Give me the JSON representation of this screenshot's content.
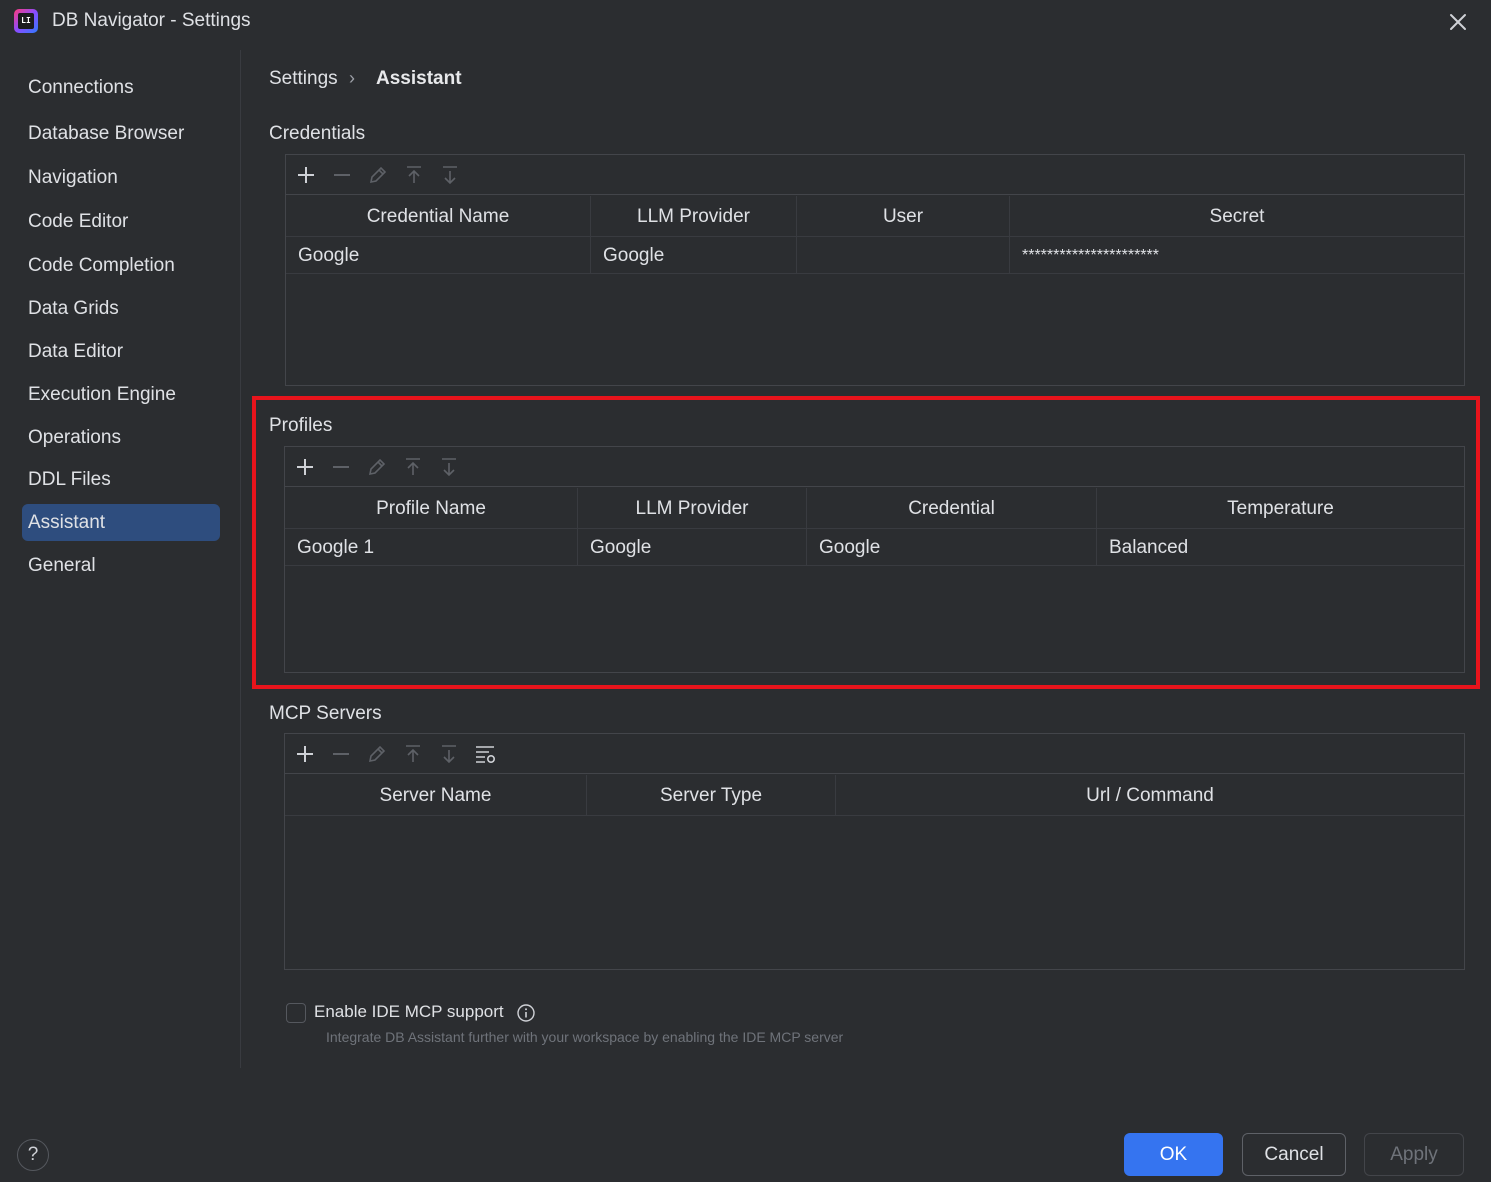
{
  "window": {
    "title": "DB Navigator - Settings",
    "app_icon_text": "LI"
  },
  "sidebar": {
    "items": [
      {
        "label": "Connections"
      },
      {
        "label": "Database Browser"
      },
      {
        "label": "Navigation"
      },
      {
        "label": "Code Editor"
      },
      {
        "label": "Code Completion"
      },
      {
        "label": "Data Grids"
      },
      {
        "label": "Data Editor"
      },
      {
        "label": "Execution Engine"
      },
      {
        "label": "Operations"
      },
      {
        "label": "DDL Files"
      },
      {
        "label": "Assistant"
      },
      {
        "label": "General"
      }
    ],
    "active": "Assistant"
  },
  "breadcrumb": {
    "root": "Settings",
    "separator": "›",
    "current": "Assistant"
  },
  "credentials": {
    "label": "Credentials",
    "columns": [
      "Credential Name",
      "LLM Provider",
      "User",
      "Secret"
    ],
    "rows": [
      {
        "name": "Google",
        "provider": "Google",
        "user": "",
        "secret": "**********************"
      }
    ]
  },
  "profiles": {
    "label": "Profiles",
    "columns": [
      "Profile Name",
      "LLM Provider",
      "Credential",
      "Temperature"
    ],
    "rows": [
      {
        "name": "Google 1",
        "provider": "Google",
        "credential": "Google",
        "temperature": "Balanced"
      }
    ]
  },
  "mcp": {
    "label": "MCP Servers",
    "columns": [
      "Server Name",
      "Server Type",
      "Url / Command"
    ],
    "rows": []
  },
  "ide_mcp": {
    "label": "Enable IDE MCP support",
    "checked": false,
    "hint": "Integrate DB Assistant further with your workspace by enabling the IDE MCP server"
  },
  "footer": {
    "help": "?",
    "ok": "OK",
    "cancel": "Cancel",
    "apply": "Apply"
  },
  "colors": {
    "accent": "#3574f0",
    "active_item": "#2e4d7e",
    "highlight": "#e8141c",
    "background": "#2b2d30"
  }
}
